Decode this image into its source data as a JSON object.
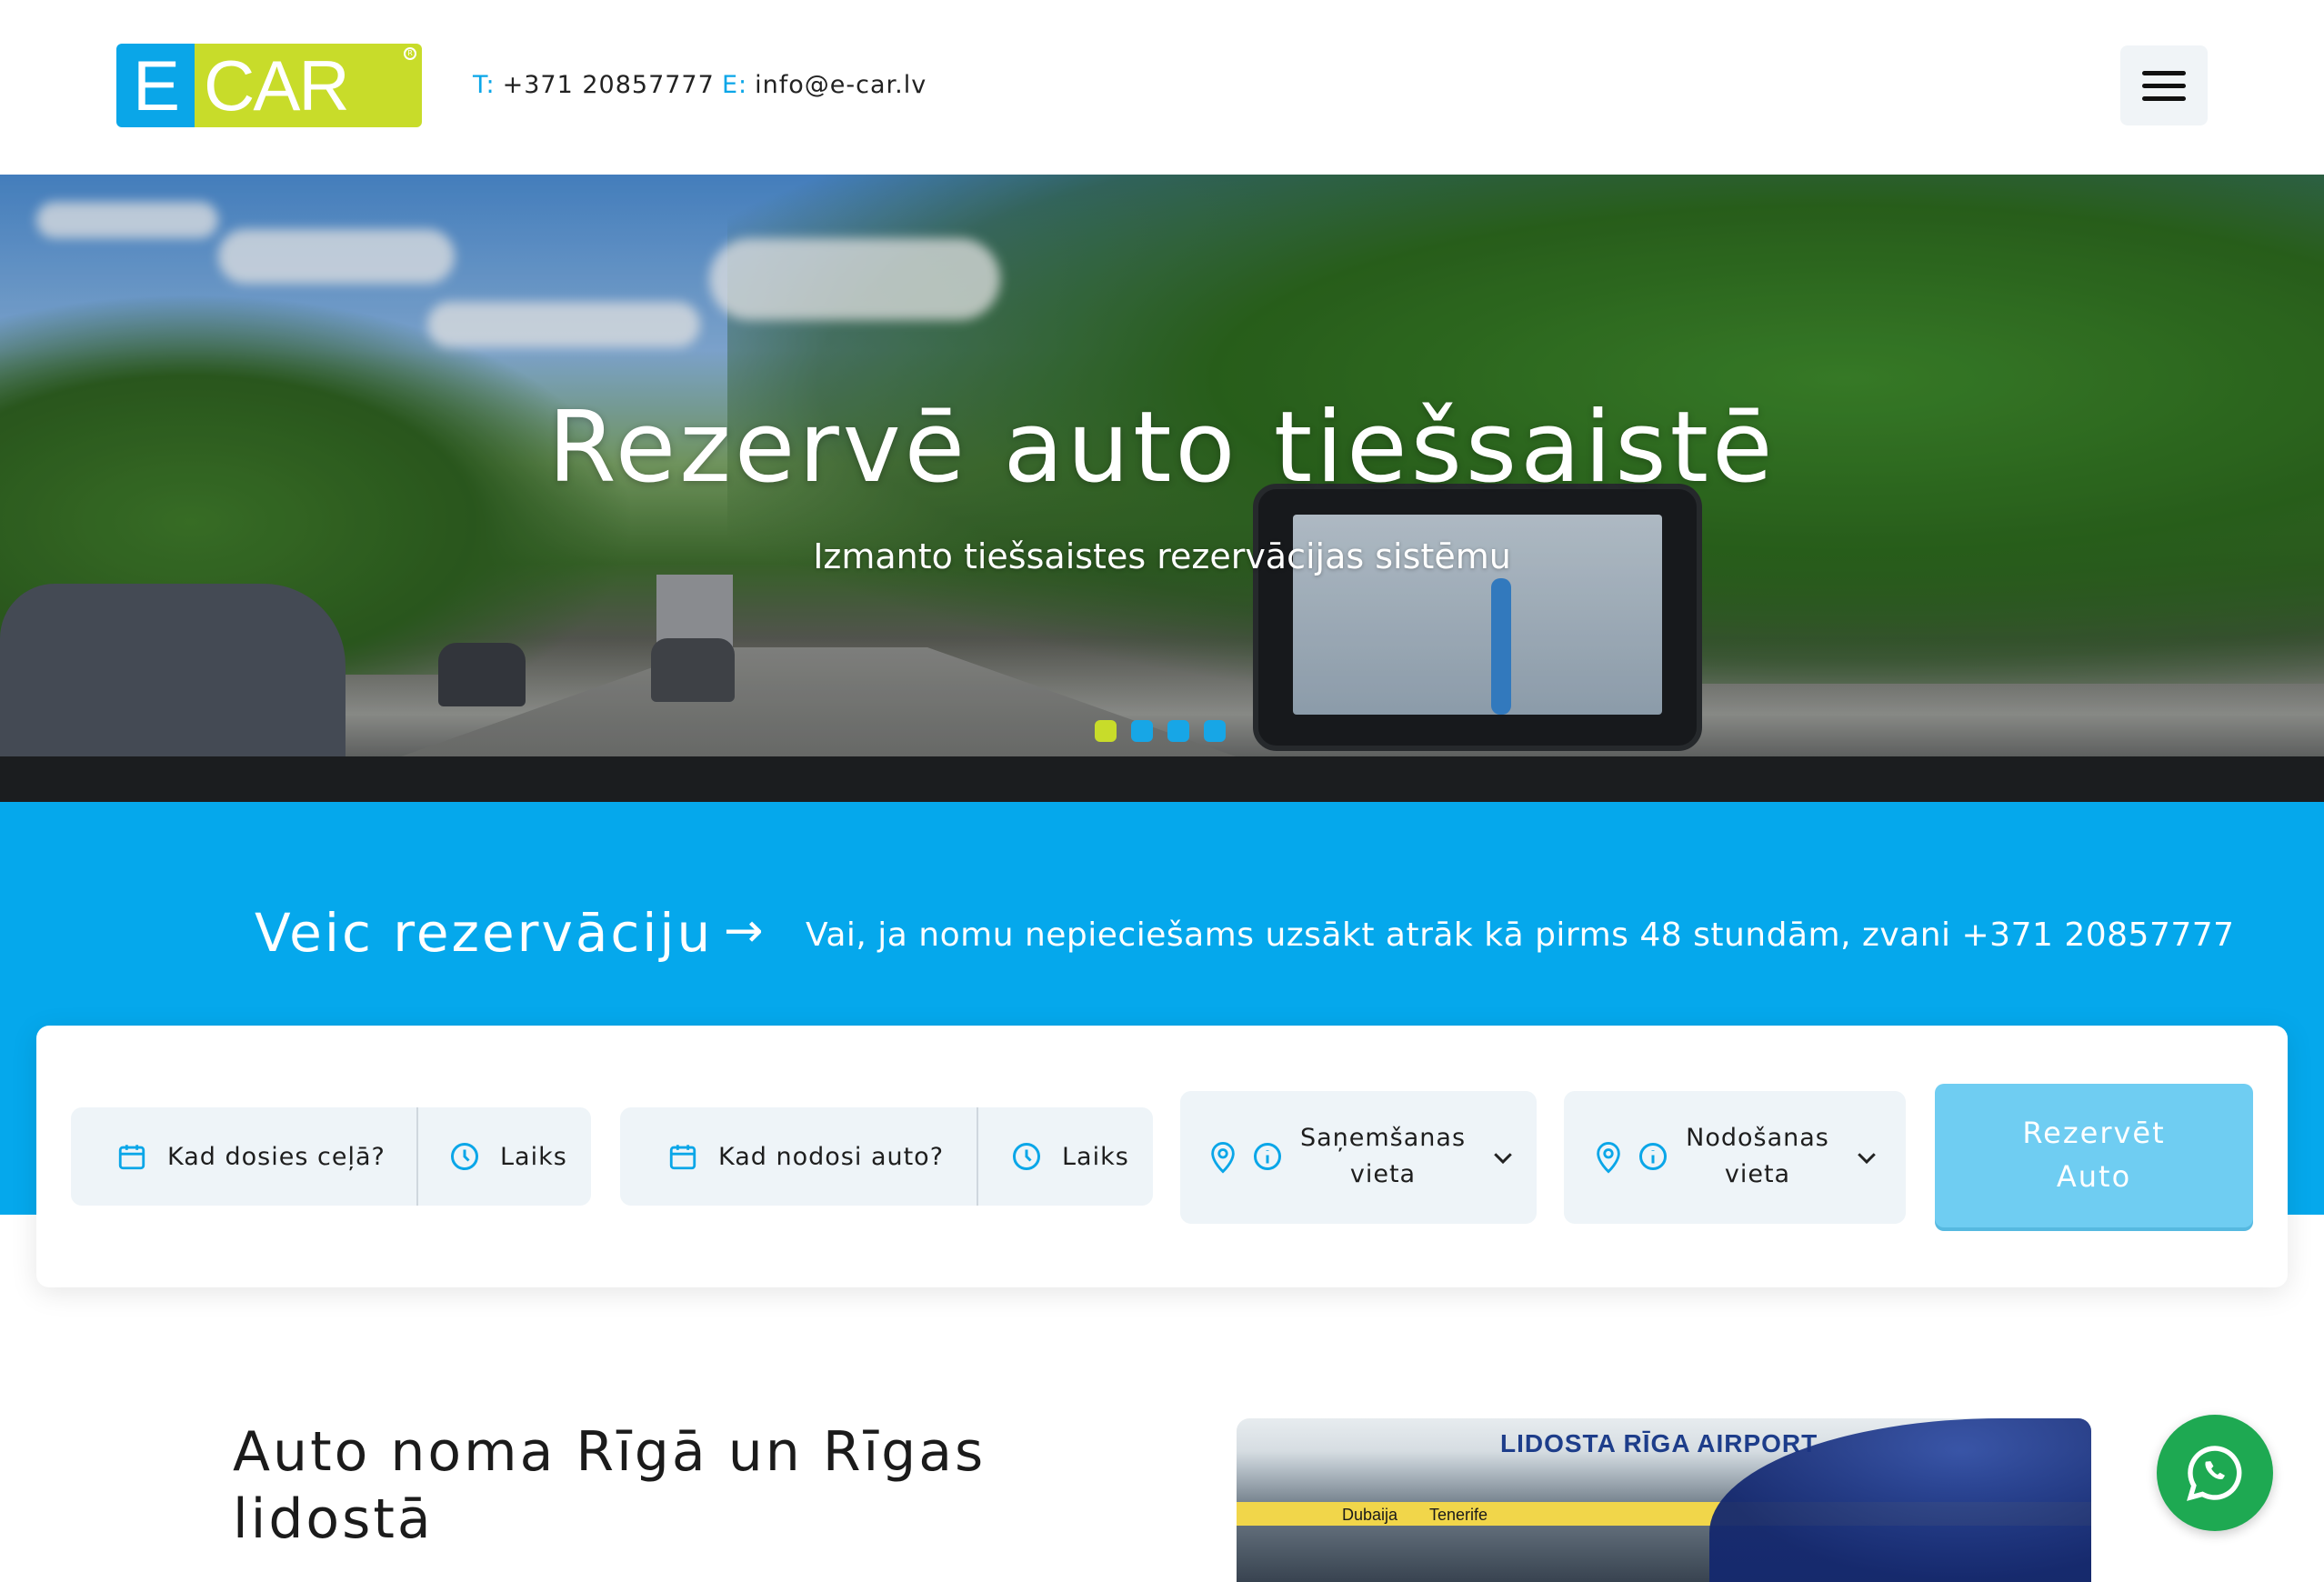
{
  "header": {
    "logo_left": "E",
    "logo_right": "CAR",
    "phone_key": "T:",
    "phone": "+371 20857777",
    "email_key": "E:",
    "email": "info@e-car.lv",
    "menu_icon": "hamburger-menu-icon"
  },
  "hero": {
    "title": "Rezervē auto tiešsaistē",
    "subtitle": "Izmanto tiešsaistes rezervācijas sistēmu",
    "slides": 4,
    "active_slide": 1,
    "dot_active_color": "#c8dc2a",
    "dot_color": "#17a6e6"
  },
  "reservation": {
    "title": "Veic rezervāciju",
    "arrow": "→",
    "note": "Vai, ja nomu nepieciešams uzsākt atrāk kā pirms 48 stundām, zvani +371 20857777",
    "band_color": "#05a8ec"
  },
  "booking": {
    "pickup_date": "Kad dosies ceļā?",
    "pickup_time": "Laiks",
    "return_date": "Kad nodosi auto?",
    "return_time": "Laiks",
    "pickup_location_line1": "Saņemšanas",
    "pickup_location_line2": "vieta",
    "return_location_line1": "Nodošanas",
    "return_location_line2": "vieta",
    "submit_line1": "Rezervēt",
    "submit_line2": "Auto",
    "icon_color": "#0aa6e8"
  },
  "content": {
    "title": "Auto noma Rīgā un Rīgas lidostā",
    "image_sign": "LIDOSTA RĪGA AIRPORT",
    "image_destinations": [
      "Dubaija",
      "Tenerife"
    ]
  },
  "whatsapp": {
    "icon": "whatsapp-icon",
    "color": "#1ea952"
  }
}
